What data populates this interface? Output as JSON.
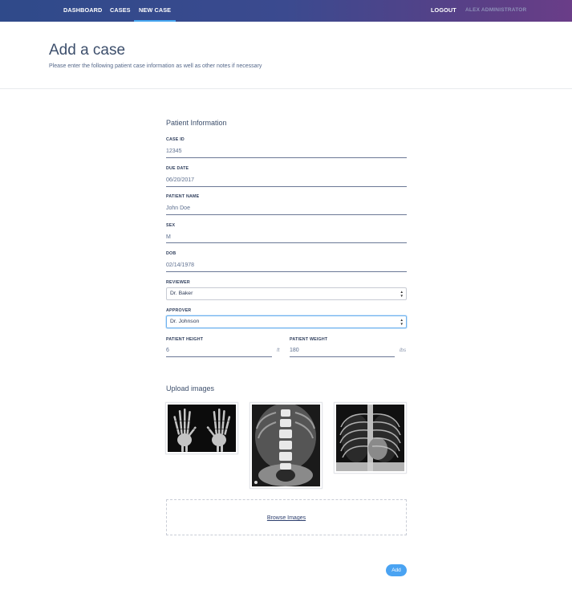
{
  "nav": {
    "items": [
      {
        "label": "DASHBOARD"
      },
      {
        "label": "CASES"
      },
      {
        "label": "NEW CASE"
      }
    ],
    "logout": "LOGOUT",
    "user": "ALEX ADMINISTRATOR",
    "active_item": "NEW CASE"
  },
  "header": {
    "title": "Add a case",
    "subtitle": "Please enter the following patient case information as well as other notes if necessary"
  },
  "patient_info": {
    "section_title": "Patient Information",
    "case_id": {
      "label": "CASE ID",
      "value": "12345"
    },
    "due_date": {
      "label": "DUE DATE",
      "value": "06/20/2017"
    },
    "patient_name": {
      "label": "PATIENT NAME",
      "value": "John Doe"
    },
    "sex": {
      "label": "SEX",
      "value": "M"
    },
    "dob": {
      "label": "DOB",
      "value": "02/14/1978"
    },
    "reviewer": {
      "label": "REVIEWER",
      "value": "Dr. Baker"
    },
    "approver": {
      "label": "APPROVER",
      "value": "Dr. Johnson"
    },
    "height": {
      "label": "PATIENT HEIGHT",
      "value": "6",
      "unit": "ft"
    },
    "weight": {
      "label": "PATIENT WEIGHT",
      "value": "180",
      "unit": "lbs"
    }
  },
  "upload": {
    "section_title": "Upload images",
    "images": [
      {
        "name": "hands-xray"
      },
      {
        "name": "spine-xray"
      },
      {
        "name": "chest-xray"
      }
    ],
    "browse_label": "Browse Images"
  },
  "actions": {
    "add_label": "Add"
  },
  "colors": {
    "accent": "#4aa3f2",
    "nav_gradient_start": "#2f4a8a",
    "nav_gradient_end": "#6a3d88"
  }
}
